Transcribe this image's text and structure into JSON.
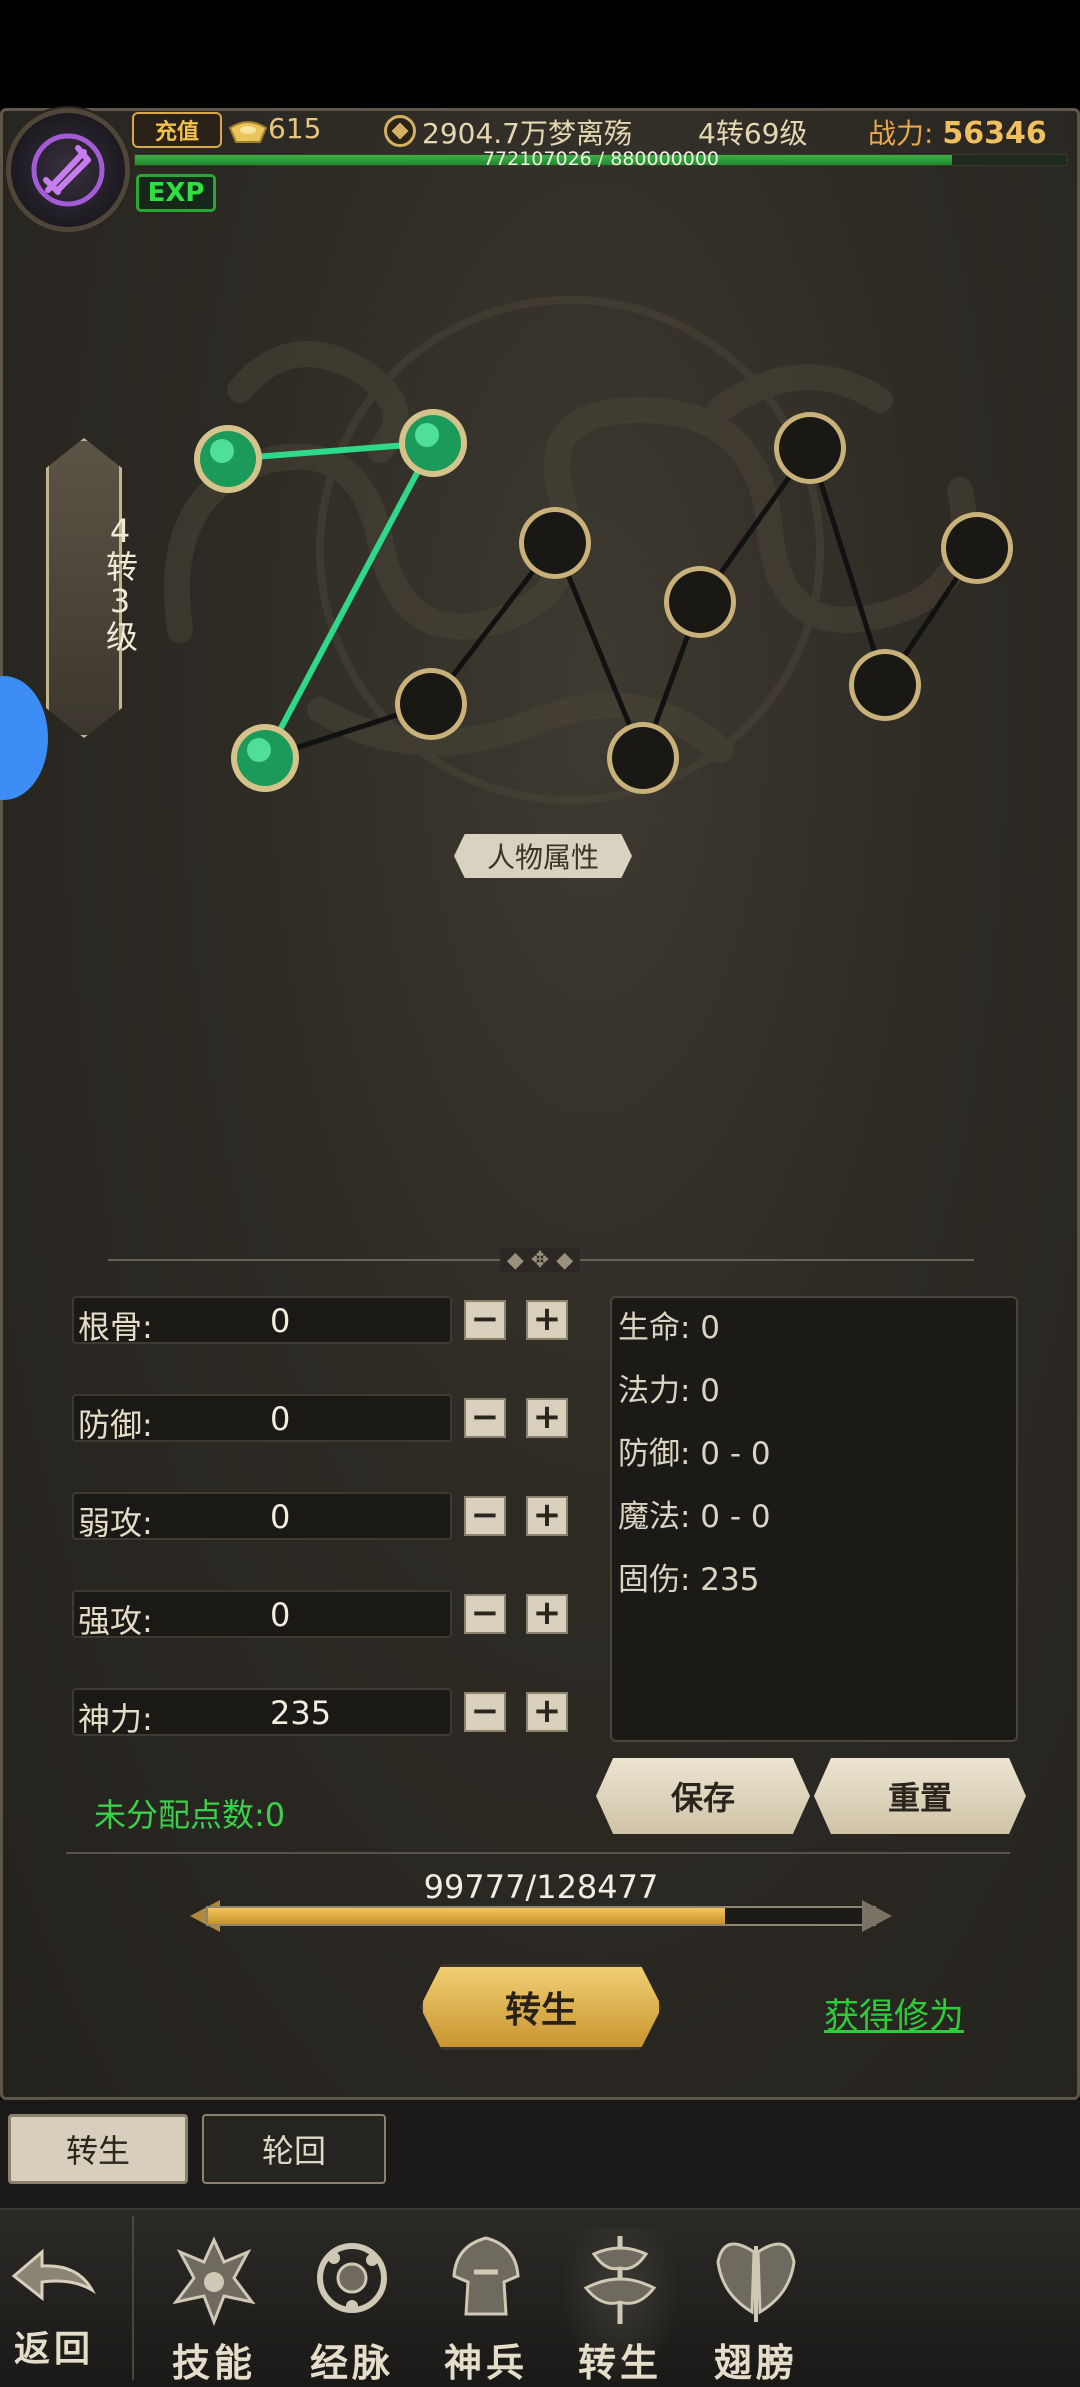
{
  "header": {
    "recharge_label": "充值",
    "gold": "615",
    "coins": "2904.7万梦离殇",
    "level": "4转69级",
    "power_label": "战力:",
    "power_value": "56346",
    "exp_text": "772107026 / 880000000",
    "exp_fraction": 0.877,
    "exp_badge": "EXP"
  },
  "tier": {
    "label": "4转3级"
  },
  "constellation": {
    "active_color": "#2fd98a",
    "inactive_color": "#c9b27a"
  },
  "attr_title": "人物属性",
  "stats": [
    {
      "label": "根骨:",
      "value": "0"
    },
    {
      "label": "防御:",
      "value": "0"
    },
    {
      "label": "弱攻:",
      "value": "0"
    },
    {
      "label": "强攻:",
      "value": "0"
    },
    {
      "label": "神力:",
      "value": "235"
    }
  ],
  "stat_buttons": {
    "minus": "−",
    "plus": "+"
  },
  "results": [
    "生命: 0",
    "法力: 0",
    "防御: 0 - 0",
    "魔法: 0 - 0",
    "固伤: 235"
  ],
  "unassigned": "未分配点数:0",
  "buttons": {
    "save": "保存",
    "reset": "重置",
    "rebirth": "转生",
    "gain_link": "获得修为"
  },
  "progress": {
    "text": "99777/128477",
    "fraction": 0.777
  },
  "subtabs": [
    {
      "label": "转生",
      "active": true
    },
    {
      "label": "轮回",
      "active": false
    }
  ],
  "nav": {
    "back": "返回",
    "items": [
      {
        "label": "技能",
        "icon": "skill-icon"
      },
      {
        "label": "经脉",
        "icon": "meridian-icon"
      },
      {
        "label": "神兵",
        "icon": "weapon-icon"
      },
      {
        "label": "转生",
        "icon": "rebirth-icon"
      },
      {
        "label": "翅膀",
        "icon": "wings-icon"
      }
    ]
  }
}
